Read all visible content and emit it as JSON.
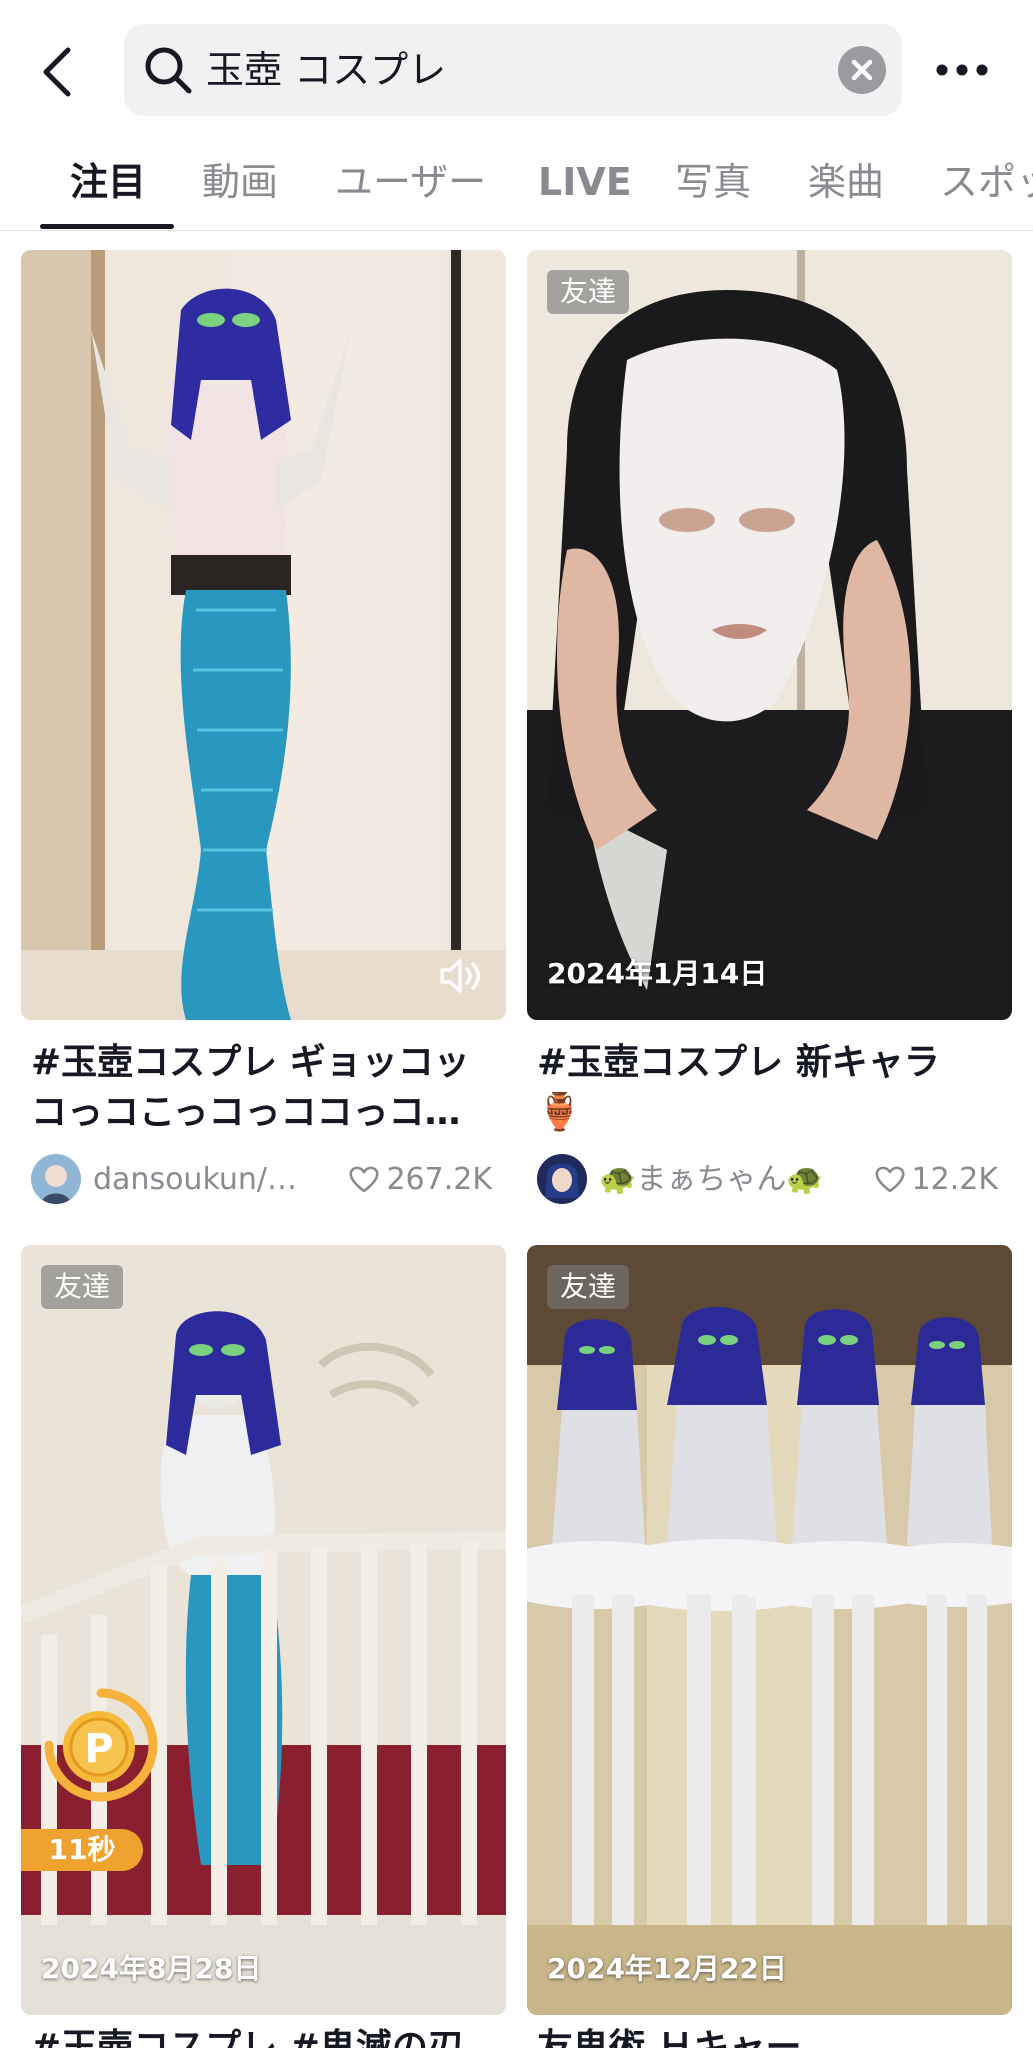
{
  "search": {
    "query": "玉壺 コスプレ"
  },
  "tabs": [
    {
      "label": "注目"
    },
    {
      "label": "動画"
    },
    {
      "label": "ユーザー"
    },
    {
      "label": "LIVE"
    },
    {
      "label": "写真"
    },
    {
      "label": "楽曲"
    },
    {
      "label": "スポッ"
    }
  ],
  "icons": {
    "back": "chevron-left-icon",
    "search": "search-icon",
    "clear": "clear-icon",
    "more": "more-icon",
    "sound": "sound-on-icon",
    "heart": "heart-icon",
    "points": "points-coin-icon"
  },
  "colors": {
    "text": "#161823",
    "muted": "#8a8b91",
    "timer_badge": "#f0a230"
  },
  "results": [
    {
      "caption_line1": "#玉壺コスプレ ギョッコッ",
      "caption_line2": "コっコこっコっココっコ…",
      "username": "dansoukun/…",
      "likes": "267.2K",
      "has_sound_icon": true
    },
    {
      "badge": "友達",
      "date": "2024年1月14日",
      "caption_line1": "#玉壺コスプレ 新キャラ",
      "caption_line2": "🏺",
      "username": "🐢まぁちゃん🐢",
      "likes": "12.2K"
    },
    {
      "badge": "友達",
      "date": "2024年8月28日",
      "timer": "11秒",
      "caption_line1": "#玉壺コスプレ #鬼滅の刃"
    },
    {
      "badge": "友達",
      "date": "2024年12月22日",
      "caption_line1": "友鬼術 Ｈキャー",
      "caption_line1_note": ""
    }
  ]
}
